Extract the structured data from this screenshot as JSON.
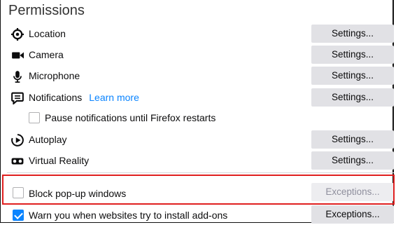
{
  "section_title": "Permissions",
  "permissions": [
    {
      "icon": "location-icon",
      "label": "Location",
      "button": "Settings..."
    },
    {
      "icon": "camera-icon",
      "label": "Camera",
      "button": "Settings..."
    },
    {
      "icon": "microphone-icon",
      "label": "Microphone",
      "button": "Settings..."
    },
    {
      "icon": "notifications-icon",
      "label": "Notifications",
      "link": "Learn more",
      "button": "Settings..."
    },
    {
      "icon": "autoplay-icon",
      "label": "Autoplay",
      "button": "Settings..."
    },
    {
      "icon": "virtual-reality-icon",
      "label": "Virtual Reality",
      "button": "Settings..."
    }
  ],
  "pause_notifications": {
    "label": "Pause notifications until Firefox restarts",
    "checked": false
  },
  "block_popups": {
    "label": "Block pop-up windows",
    "checked": false,
    "button": "Exceptions..."
  },
  "warn_addons": {
    "label": "Warn you when websites try to install add-ons",
    "checked": true,
    "button": "Exceptions..."
  },
  "colors": {
    "accent": "#0a84ff",
    "highlight": "#e02020",
    "button_bg": "#e1e1e5"
  }
}
